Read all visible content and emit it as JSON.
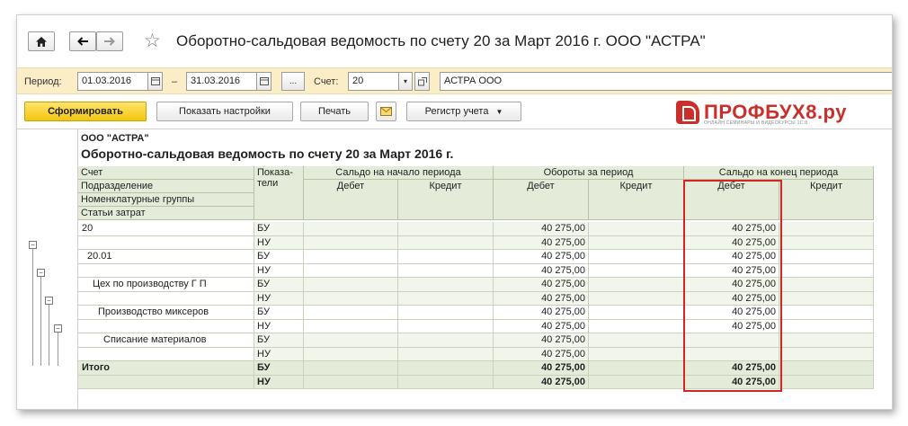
{
  "window": {
    "title": "Оборотно-сальдовая ведомость по счету 20 за Март 2016 г. ООО \"АСТРА\"",
    "home_icon": "home-icon",
    "back_icon": "arrow-left-icon",
    "forward_icon": "arrow-right-icon",
    "favorite_icon": "star-icon"
  },
  "params": {
    "period_label": "Период:",
    "date_from": "01.03.2016",
    "date_sep": "–",
    "date_to": "31.03.2016",
    "more_label": "...",
    "account_label": "Счет:",
    "account_value": "20",
    "org_value": "АСТРА ООО"
  },
  "toolbar": {
    "generate_label": "Сформировать",
    "settings_label": "Показать настройки",
    "print_label": "Печать",
    "register_label": "Регистр учета"
  },
  "logo": {
    "text": "ПРОФБУХ8.ру",
    "sub": "ОНЛАЙН СЕМИНАРЫ И ВИДЕОКУРСЫ 1С:8"
  },
  "report": {
    "org": "ООО \"АСТРА\"",
    "title": "Оборотно-сальдовая ведомость по счету 20 за Март 2016 г.",
    "headers": {
      "account_levels": [
        "Счет",
        "Подразделение",
        "Номенклатурные группы",
        "Статьи затрат"
      ],
      "indicator": "Показа-\nтели",
      "opening": "Сальдо на начало периода",
      "turnover": "Обороты за период",
      "closing": "Сальдо на конец периода",
      "debit": "Дебет",
      "credit": "Кредит"
    },
    "rows": [
      {
        "name": "20",
        "ind": "БУ",
        "o_d": "",
        "o_c": "",
        "t_d": "40 275,00",
        "t_c": "",
        "c_d": "40 275,00",
        "c_c": ""
      },
      {
        "name": "",
        "ind": "НУ",
        "o_d": "",
        "o_c": "",
        "t_d": "40 275,00",
        "t_c": "",
        "c_d": "40 275,00",
        "c_c": ""
      },
      {
        "name": "20.01",
        "ind": "БУ",
        "o_d": "",
        "o_c": "",
        "t_d": "40 275,00",
        "t_c": "",
        "c_d": "40 275,00",
        "c_c": ""
      },
      {
        "name": "",
        "ind": "НУ",
        "o_d": "",
        "o_c": "",
        "t_d": "40 275,00",
        "t_c": "",
        "c_d": "40 275,00",
        "c_c": ""
      },
      {
        "name": "Цех по производству Г П",
        "ind": "БУ",
        "o_d": "",
        "o_c": "",
        "t_d": "40 275,00",
        "t_c": "",
        "c_d": "40 275,00",
        "c_c": ""
      },
      {
        "name": "",
        "ind": "НУ",
        "o_d": "",
        "o_c": "",
        "t_d": "40 275,00",
        "t_c": "",
        "c_d": "40 275,00",
        "c_c": ""
      },
      {
        "name": "Производство миксеров",
        "ind": "БУ",
        "o_d": "",
        "o_c": "",
        "t_d": "40 275,00",
        "t_c": "",
        "c_d": "40 275,00",
        "c_c": ""
      },
      {
        "name": "",
        "ind": "НУ",
        "o_d": "",
        "o_c": "",
        "t_d": "40 275,00",
        "t_c": "",
        "c_d": "40 275,00",
        "c_c": ""
      },
      {
        "name": "Списание материалов",
        "ind": "БУ",
        "o_d": "",
        "o_c": "",
        "t_d": "40 275,00",
        "t_c": "",
        "c_d": "",
        "c_c": ""
      },
      {
        "name": "",
        "ind": "НУ",
        "o_d": "",
        "o_c": "",
        "t_d": "40 275,00",
        "t_c": "",
        "c_d": "",
        "c_c": ""
      },
      {
        "name": "Итого",
        "ind": "БУ",
        "o_d": "",
        "o_c": "",
        "t_d": "40 275,00",
        "t_c": "",
        "c_d": "40 275,00",
        "c_c": "",
        "total": true
      },
      {
        "name": "",
        "ind": "НУ",
        "o_d": "",
        "o_c": "",
        "t_d": "40 275,00",
        "t_c": "",
        "c_d": "40 275,00",
        "c_c": "",
        "total": true
      }
    ]
  },
  "colors": {
    "accent_yellow": "#f2c610",
    "header_green": "#e4ecd9",
    "highlight_red": "#d42424",
    "logo_red": "#c9302c"
  }
}
